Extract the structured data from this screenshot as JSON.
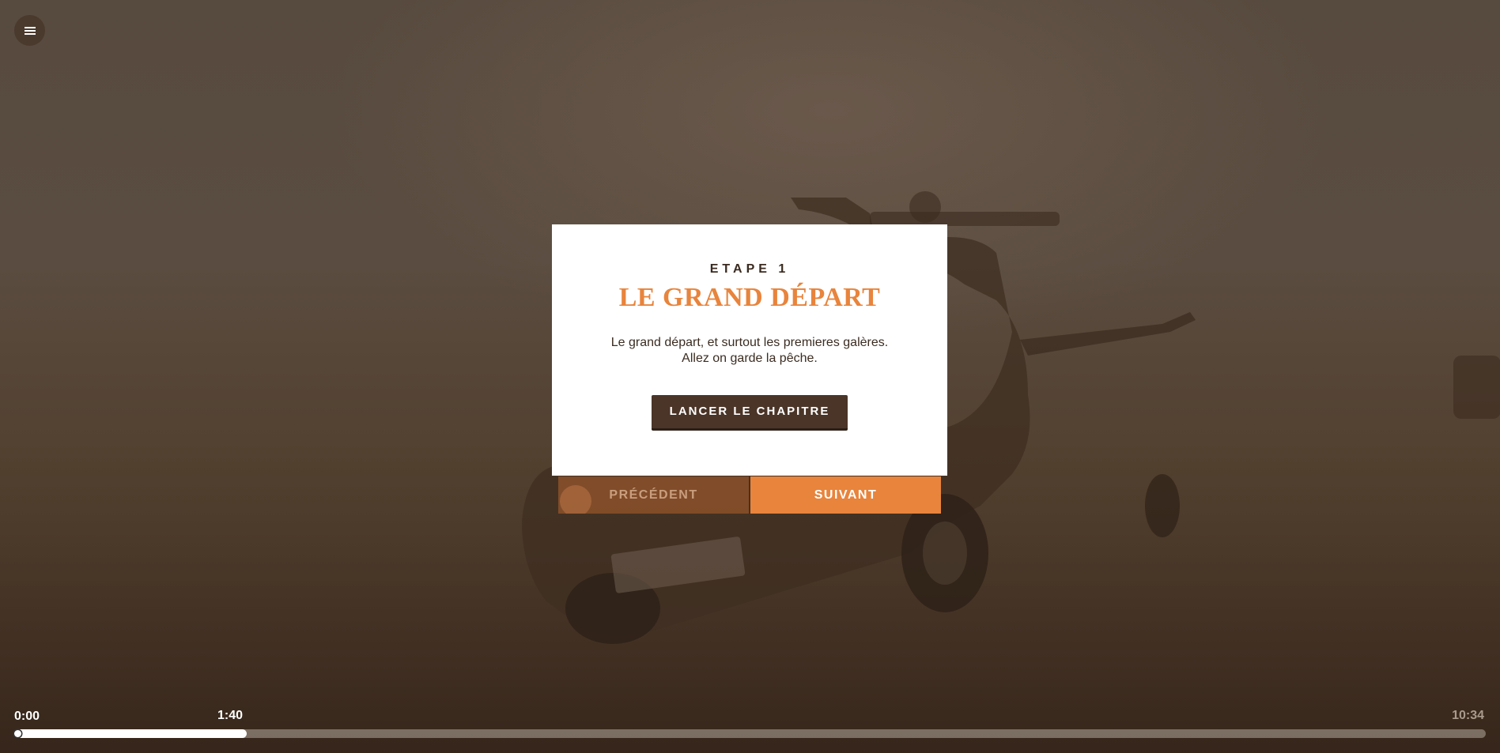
{
  "menu": {
    "icon": "hamburger-menu-icon"
  },
  "chapter": {
    "eyebrow": "ETAPE 1",
    "title": "LE GRAND DÉPART",
    "description_line1": "Le grand départ, et surtout les premieres galères.",
    "description_line2": "Allez on garde la pêche.",
    "launch_label": "LANCER LE CHAPITRE"
  },
  "navigation": {
    "prev_label": "PRÉCÉDENT",
    "next_label": "SUIVANT"
  },
  "player": {
    "start_time": "0:00",
    "current_time": "1:40",
    "total_time": "10:34",
    "progress": 0.158
  },
  "colors": {
    "accent": "#e8843c",
    "dark": "#4b3528",
    "text": "#3b2c21"
  }
}
